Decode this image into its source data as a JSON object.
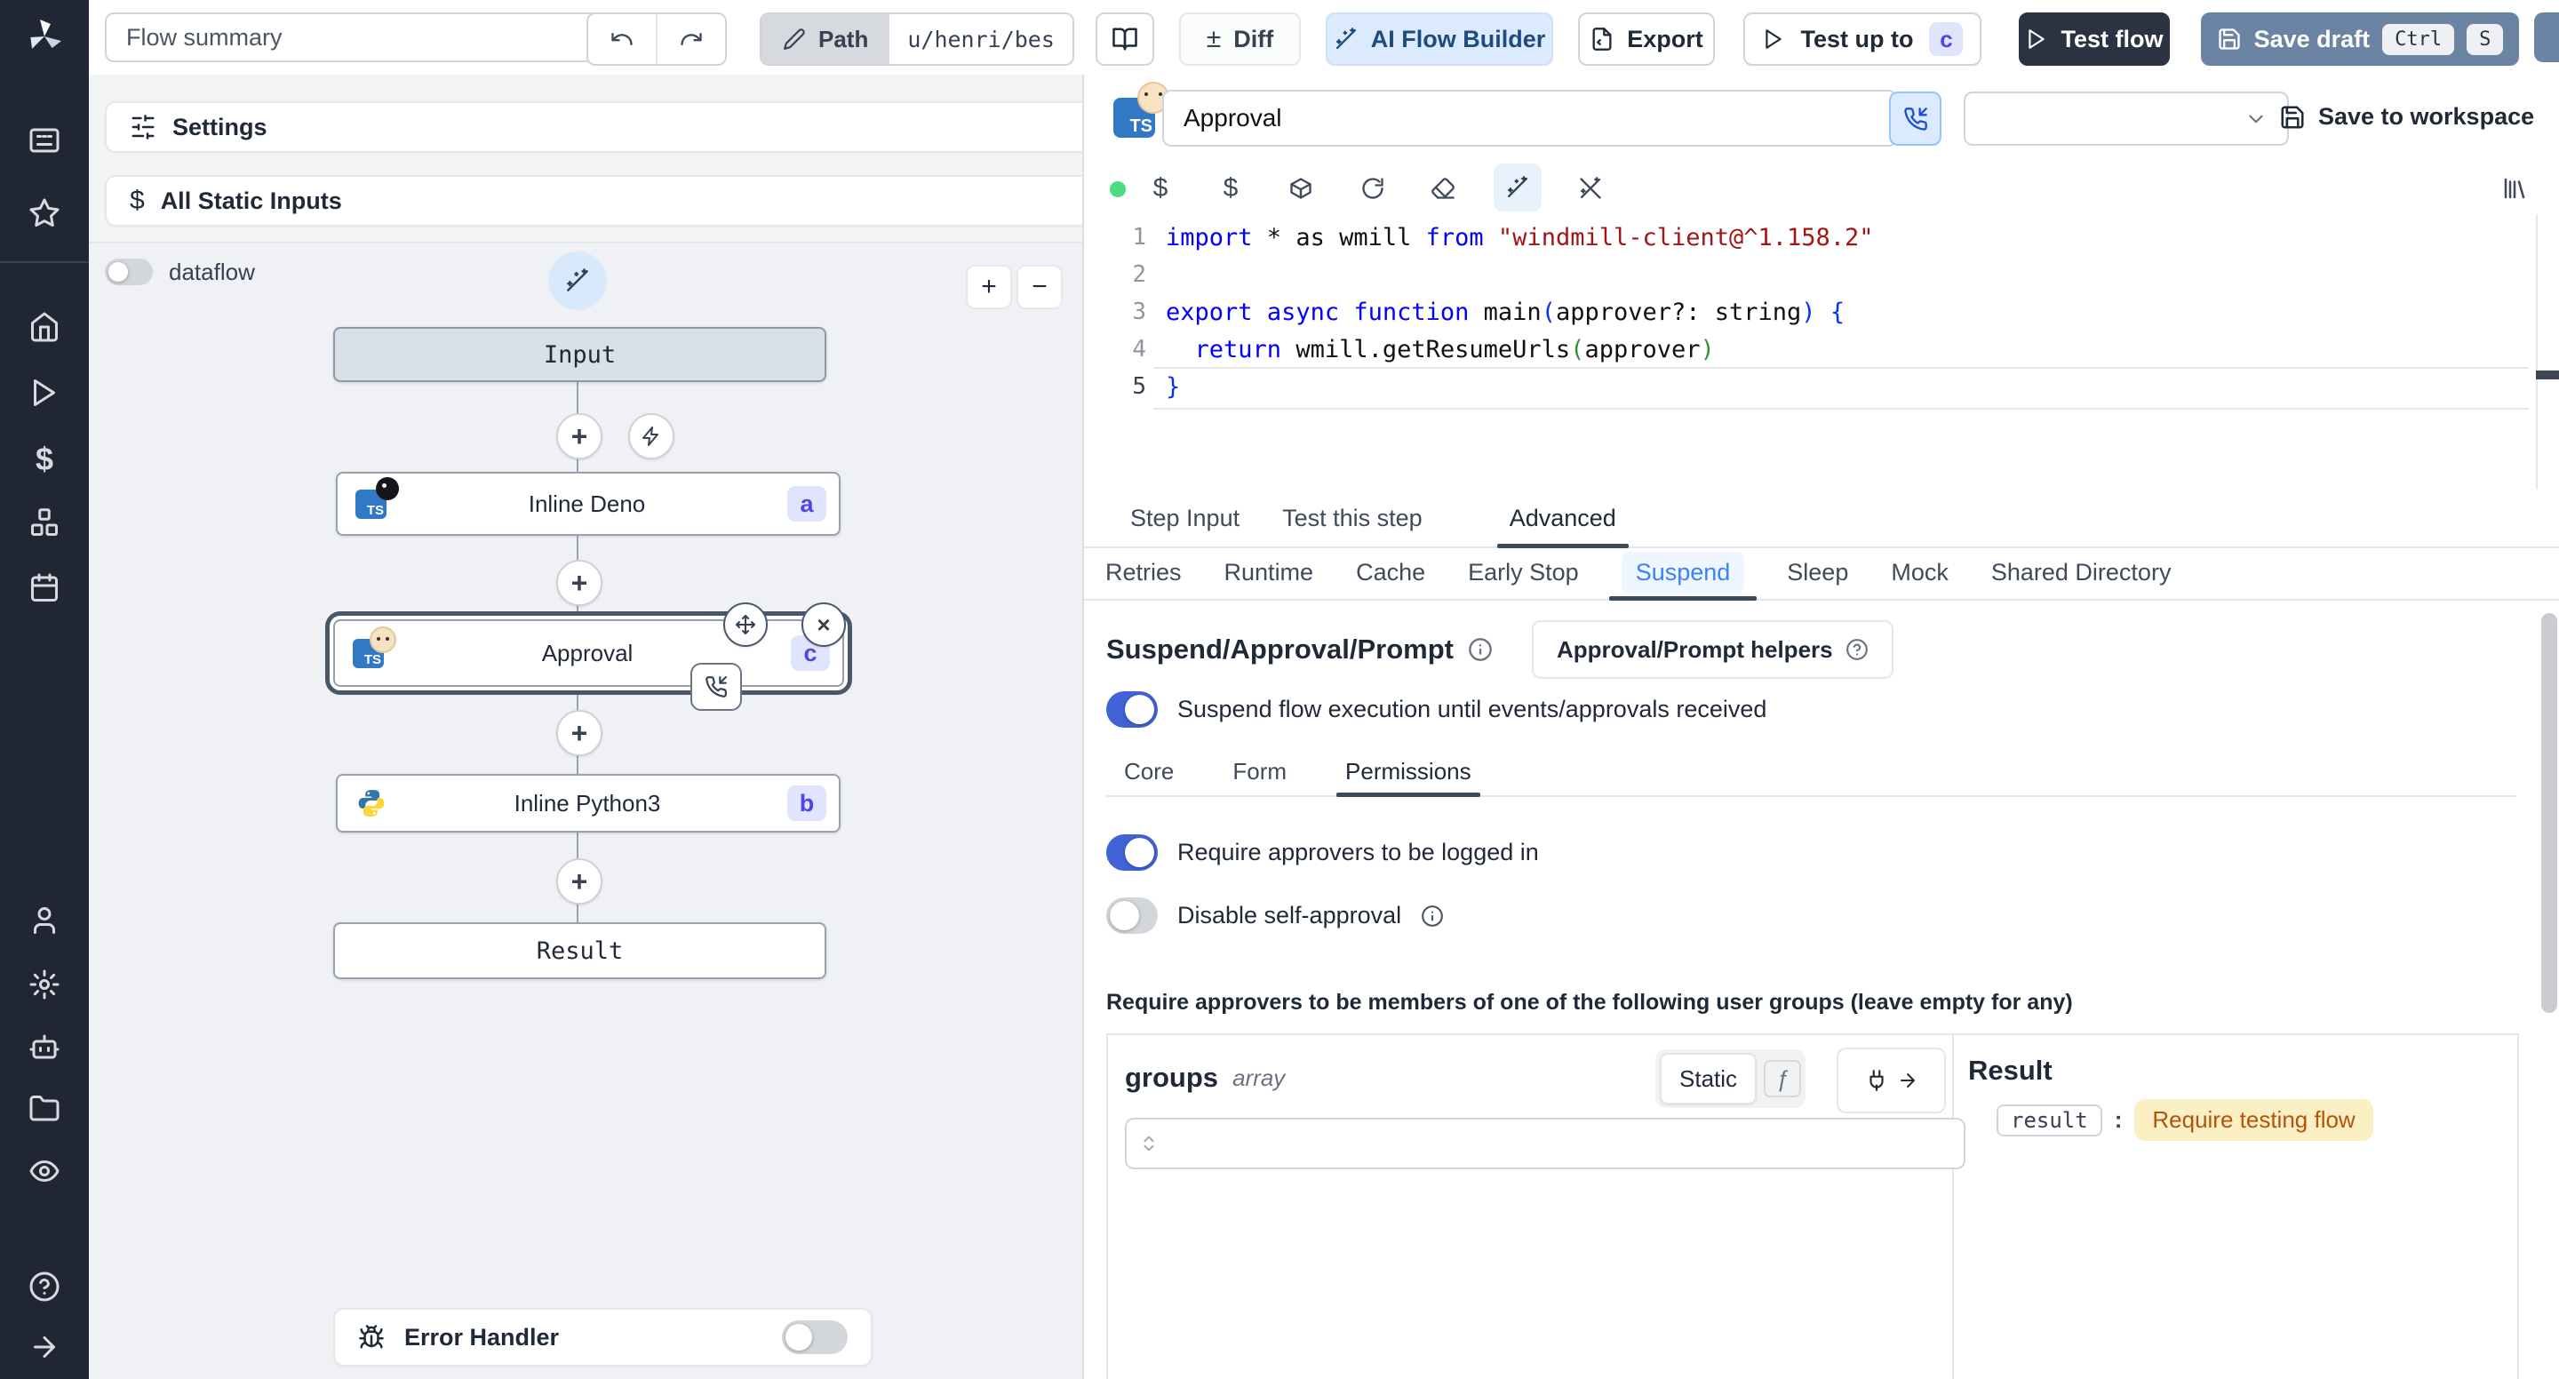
{
  "header": {
    "flow_summary": "Flow summary",
    "path_label": "Path",
    "path_value": "u/henri/bes",
    "diff_sign": "±",
    "diff_label": "Diff",
    "ai_flow_builder_label": "AI Flow Builder",
    "export_label": "Export",
    "test_up_to_label": "Test up to",
    "test_up_to_badge": "c",
    "test_flow_label": "Test flow",
    "save_draft_label": "Save draft",
    "save_draft_kbd": [
      "Ctrl",
      "S"
    ]
  },
  "left_panel": {
    "settings_label": "Settings",
    "all_static_inputs_label": "All Static Inputs",
    "dataflow_label": "dataflow",
    "zoom_in": "+",
    "zoom_out": "−",
    "error_handler_label": "Error Handler"
  },
  "graph": {
    "input_label": "Input",
    "deno_label": "Inline Deno",
    "deno_badge": "a",
    "approval_label": "Approval",
    "approval_badge": "c",
    "python_label": "Inline Python3",
    "python_badge": "b",
    "result_label": "Result",
    "ts_chip": "TS"
  },
  "step_editor": {
    "name_value": "Approval",
    "save_to_workspace_label": "Save to workspace",
    "ts_chip": "TS"
  },
  "code": {
    "lines": [
      {
        "num": "1",
        "tokens": [
          "import",
          " * as wmill ",
          "from",
          " ",
          "\"windmill-client@^1.158.2\""
        ]
      },
      {
        "num": "2",
        "tokens": []
      },
      {
        "num": "3",
        "tokens": [
          "export",
          " ",
          "async",
          " ",
          "function",
          " main",
          "(",
          "approver?: string",
          ")",
          " ",
          "{"
        ]
      },
      {
        "num": "4",
        "tokens": [
          "  ",
          "return",
          " wmill.getResumeUrls",
          "(",
          "approver",
          ")"
        ]
      },
      {
        "num": "5",
        "tokens": [
          "}"
        ]
      }
    ]
  },
  "tabs": {
    "step": {
      "items": [
        "Step Input",
        "Test this step",
        "Advanced"
      ]
    },
    "advanced": {
      "items": [
        "Retries",
        "Runtime",
        "Cache",
        "Early Stop",
        "Suspend",
        "Sleep",
        "Mock",
        "Shared Directory"
      ]
    },
    "suspend_sub": {
      "items": [
        "Core",
        "Form",
        "Permissions"
      ]
    }
  },
  "suspend": {
    "title": "Suspend/Approval/Prompt",
    "helpers_button_label": "Approval/Prompt helpers",
    "suspend_toggle_label": "Suspend flow execution until events/approvals received",
    "require_login_label": "Require approvers to be logged in",
    "disable_self_approval_label": "Disable self-approval",
    "groups_note": "Require approvers to be members of one of the following user groups (leave empty for any)",
    "groups_field": {
      "name": "groups",
      "type": "array",
      "static_label": "Static",
      "fn_label": "ƒ"
    }
  },
  "result_panel": {
    "title": "Result",
    "key": "result",
    "colon": ":",
    "value": "Require testing flow"
  },
  "colors": {
    "toggle-on": "#4263d7",
    "badge-bg": "#e0e4fc",
    "badge-text": "#4f46e5",
    "suspend-text": "#3b82f6",
    "suspend-bg": "#eef6ff",
    "pill-bg": "#fbf0c4",
    "pill-text": "#b45309",
    "save-draft-bg": "#6c84a3",
    "test-flow-bg": "#2b3342",
    "ai-bg": "#dbeafd",
    "ai-text": "#1f4b7d",
    "ts-blue": "#3178c6",
    "sidebar-bg": "#202633",
    "status-green": "#4ade80"
  }
}
